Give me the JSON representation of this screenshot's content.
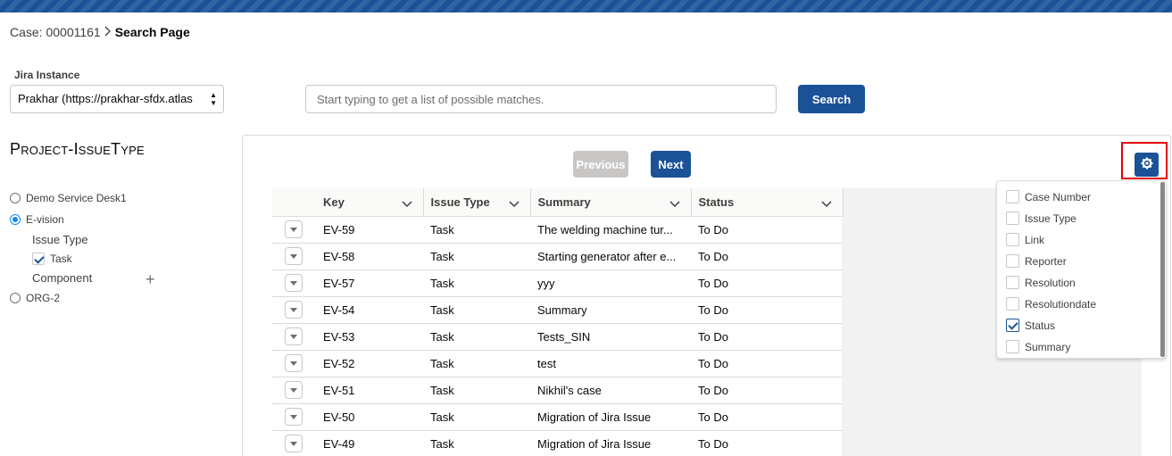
{
  "breadcrumb": {
    "case_label": "Case: 00001161",
    "current_page": "Search Page"
  },
  "jira_instance": {
    "label": "Jira Instance",
    "selected_value": "Prakhar (https://prakhar-sfdx.atlas"
  },
  "search": {
    "placeholder": "Start typing to get a list of possible matches.",
    "button_label": "Search"
  },
  "sidebar": {
    "title": "Project-IssueType",
    "projects": [
      {
        "label": "Demo Service Desk1",
        "selected": false
      },
      {
        "label": "E-vision",
        "selected": true
      },
      {
        "label": "ORG-2",
        "selected": false
      }
    ],
    "issue_type_label": "Issue Type",
    "issue_type_option": {
      "label": "Task",
      "checked": true
    },
    "component_label": "Component",
    "add_icon": "plus-icon"
  },
  "pagination": {
    "previous_label": "Previous",
    "next_label": "Next"
  },
  "settings": {
    "icon": "gear-icon",
    "highlight_color": "#e3000f"
  },
  "table": {
    "columns": [
      "Key",
      "Issue Type",
      "Summary",
      "Status"
    ],
    "rows": [
      {
        "key": "EV-59",
        "issue_type": "Task",
        "summary": "The welding machine tur...",
        "status": "To Do"
      },
      {
        "key": "EV-58",
        "issue_type": "Task",
        "summary": "Starting generator after e...",
        "status": "To Do"
      },
      {
        "key": "EV-57",
        "issue_type": "Task",
        "summary": "yyy",
        "status": "To Do"
      },
      {
        "key": "EV-54",
        "issue_type": "Task",
        "summary": "Summary",
        "status": "To Do"
      },
      {
        "key": "EV-53",
        "issue_type": "Task",
        "summary": "Tests_SIN",
        "status": "To Do"
      },
      {
        "key": "EV-52",
        "issue_type": "Task",
        "summary": "test",
        "status": "To Do"
      },
      {
        "key": "EV-51",
        "issue_type": "Task",
        "summary": "Nikhil's case",
        "status": "To Do"
      },
      {
        "key": "EV-50",
        "issue_type": "Task",
        "summary": "Migration of Jira Issue",
        "status": "To Do"
      },
      {
        "key": "EV-49",
        "issue_type": "Task",
        "summary": "Migration of Jira Issue",
        "status": "To Do"
      }
    ]
  },
  "column_menu": {
    "items": [
      {
        "label": "Case Number",
        "checked": false
      },
      {
        "label": "Issue Type",
        "checked": false
      },
      {
        "label": "Link",
        "checked": false
      },
      {
        "label": "Reporter",
        "checked": false
      },
      {
        "label": "Resolution",
        "checked": false
      },
      {
        "label": "Resolutiondate",
        "checked": false
      },
      {
        "label": "Status",
        "checked": true
      },
      {
        "label": "Summary",
        "checked": false
      }
    ]
  },
  "colors": {
    "brand": "#1b5297",
    "disabled": "#c9c7c5",
    "radio_selected": "#1589ee"
  }
}
